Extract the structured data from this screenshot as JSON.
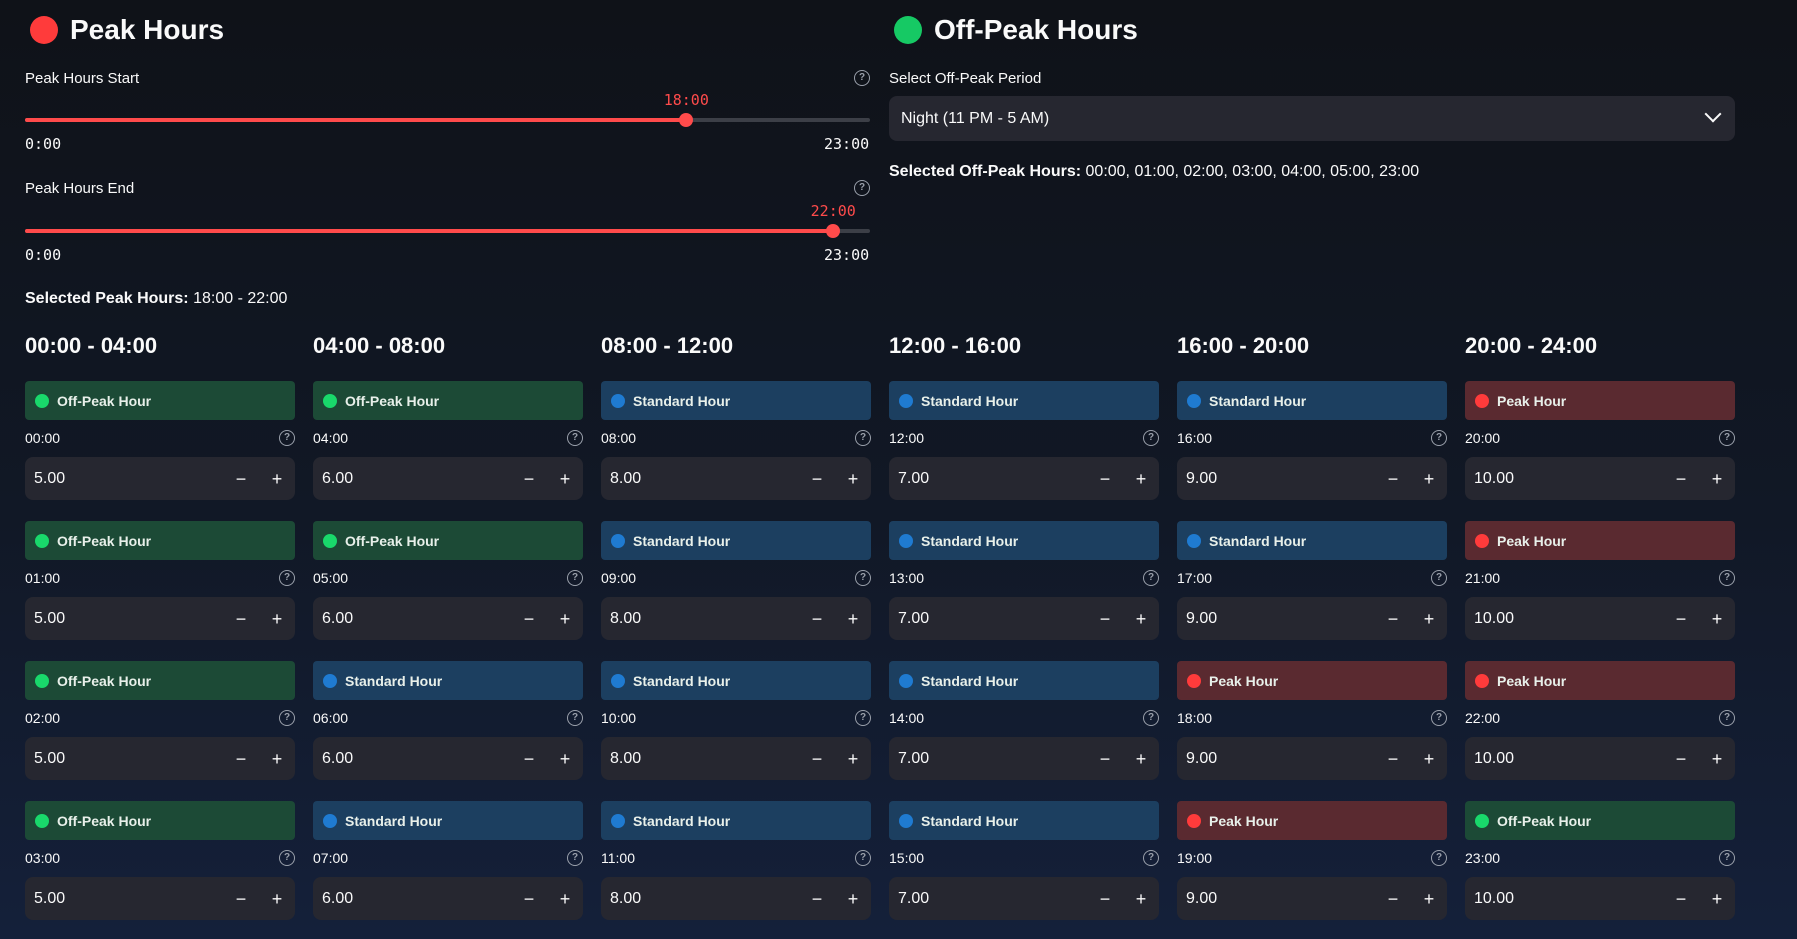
{
  "peak_section": {
    "title": "Peak Hours",
    "start_slider": {
      "label": "Peak Hours Start",
      "value": "18:00",
      "min": "0:00",
      "max": "23:00",
      "fraction": 0.7826
    },
    "end_slider": {
      "label": "Peak Hours End",
      "value": "22:00",
      "min": "0:00",
      "max": "23:00",
      "fraction": 0.9565
    },
    "selected_label": "Selected Peak Hours:",
    "selected_value": "18:00 - 22:00"
  },
  "offpeak_section": {
    "title": "Off-Peak Hours",
    "select_label": "Select Off-Peak Period",
    "select_value": "Night (11 PM - 5 AM)",
    "selected_label": "Selected Off-Peak Hours:",
    "selected_value": "00:00, 01:00, 02:00, 03:00, 04:00, 05:00, 23:00"
  },
  "help_glyph": "?",
  "step_minus": "−",
  "step_plus": "+",
  "colors": {
    "accent": "#ff4b4b",
    "offpeak": "#1c4a36",
    "standard": "#1c3f60",
    "peak": "#5a2a30"
  },
  "columns": [
    {
      "header": "00:00 - 04:00",
      "rows": [
        {
          "badge": "Off-Peak Hour",
          "type": "offpeak",
          "hour": "00:00",
          "value": "5.00"
        },
        {
          "badge": "Off-Peak Hour",
          "type": "offpeak",
          "hour": "01:00",
          "value": "5.00"
        },
        {
          "badge": "Off-Peak Hour",
          "type": "offpeak",
          "hour": "02:00",
          "value": "5.00"
        },
        {
          "badge": "Off-Peak Hour",
          "type": "offpeak",
          "hour": "03:00",
          "value": "5.00"
        }
      ]
    },
    {
      "header": "04:00 - 08:00",
      "rows": [
        {
          "badge": "Off-Peak Hour",
          "type": "offpeak",
          "hour": "04:00",
          "value": "6.00"
        },
        {
          "badge": "Off-Peak Hour",
          "type": "offpeak",
          "hour": "05:00",
          "value": "6.00"
        },
        {
          "badge": "Standard Hour",
          "type": "standard",
          "hour": "06:00",
          "value": "6.00"
        },
        {
          "badge": "Standard Hour",
          "type": "standard",
          "hour": "07:00",
          "value": "6.00"
        }
      ]
    },
    {
      "header": "08:00 - 12:00",
      "rows": [
        {
          "badge": "Standard Hour",
          "type": "standard",
          "hour": "08:00",
          "value": "8.00"
        },
        {
          "badge": "Standard Hour",
          "type": "standard",
          "hour": "09:00",
          "value": "8.00"
        },
        {
          "badge": "Standard Hour",
          "type": "standard",
          "hour": "10:00",
          "value": "8.00"
        },
        {
          "badge": "Standard Hour",
          "type": "standard",
          "hour": "11:00",
          "value": "8.00"
        }
      ]
    },
    {
      "header": "12:00 - 16:00",
      "rows": [
        {
          "badge": "Standard Hour",
          "type": "standard",
          "hour": "12:00",
          "value": "7.00"
        },
        {
          "badge": "Standard Hour",
          "type": "standard",
          "hour": "13:00",
          "value": "7.00"
        },
        {
          "badge": "Standard Hour",
          "type": "standard",
          "hour": "14:00",
          "value": "7.00"
        },
        {
          "badge": "Standard Hour",
          "type": "standard",
          "hour": "15:00",
          "value": "7.00"
        }
      ]
    },
    {
      "header": "16:00 - 20:00",
      "rows": [
        {
          "badge": "Standard Hour",
          "type": "standard",
          "hour": "16:00",
          "value": "9.00"
        },
        {
          "badge": "Standard Hour",
          "type": "standard",
          "hour": "17:00",
          "value": "9.00"
        },
        {
          "badge": "Peak Hour",
          "type": "peak",
          "hour": "18:00",
          "value": "9.00"
        },
        {
          "badge": "Peak Hour",
          "type": "peak",
          "hour": "19:00",
          "value": "9.00"
        }
      ]
    },
    {
      "header": "20:00 - 24:00",
      "rows": [
        {
          "badge": "Peak Hour",
          "type": "peak",
          "hour": "20:00",
          "value": "10.00"
        },
        {
          "badge": "Peak Hour",
          "type": "peak",
          "hour": "21:00",
          "value": "10.00"
        },
        {
          "badge": "Peak Hour",
          "type": "peak",
          "hour": "22:00",
          "value": "10.00"
        },
        {
          "badge": "Off-Peak Hour",
          "type": "offpeak",
          "hour": "23:00",
          "value": "10.00"
        }
      ]
    }
  ]
}
